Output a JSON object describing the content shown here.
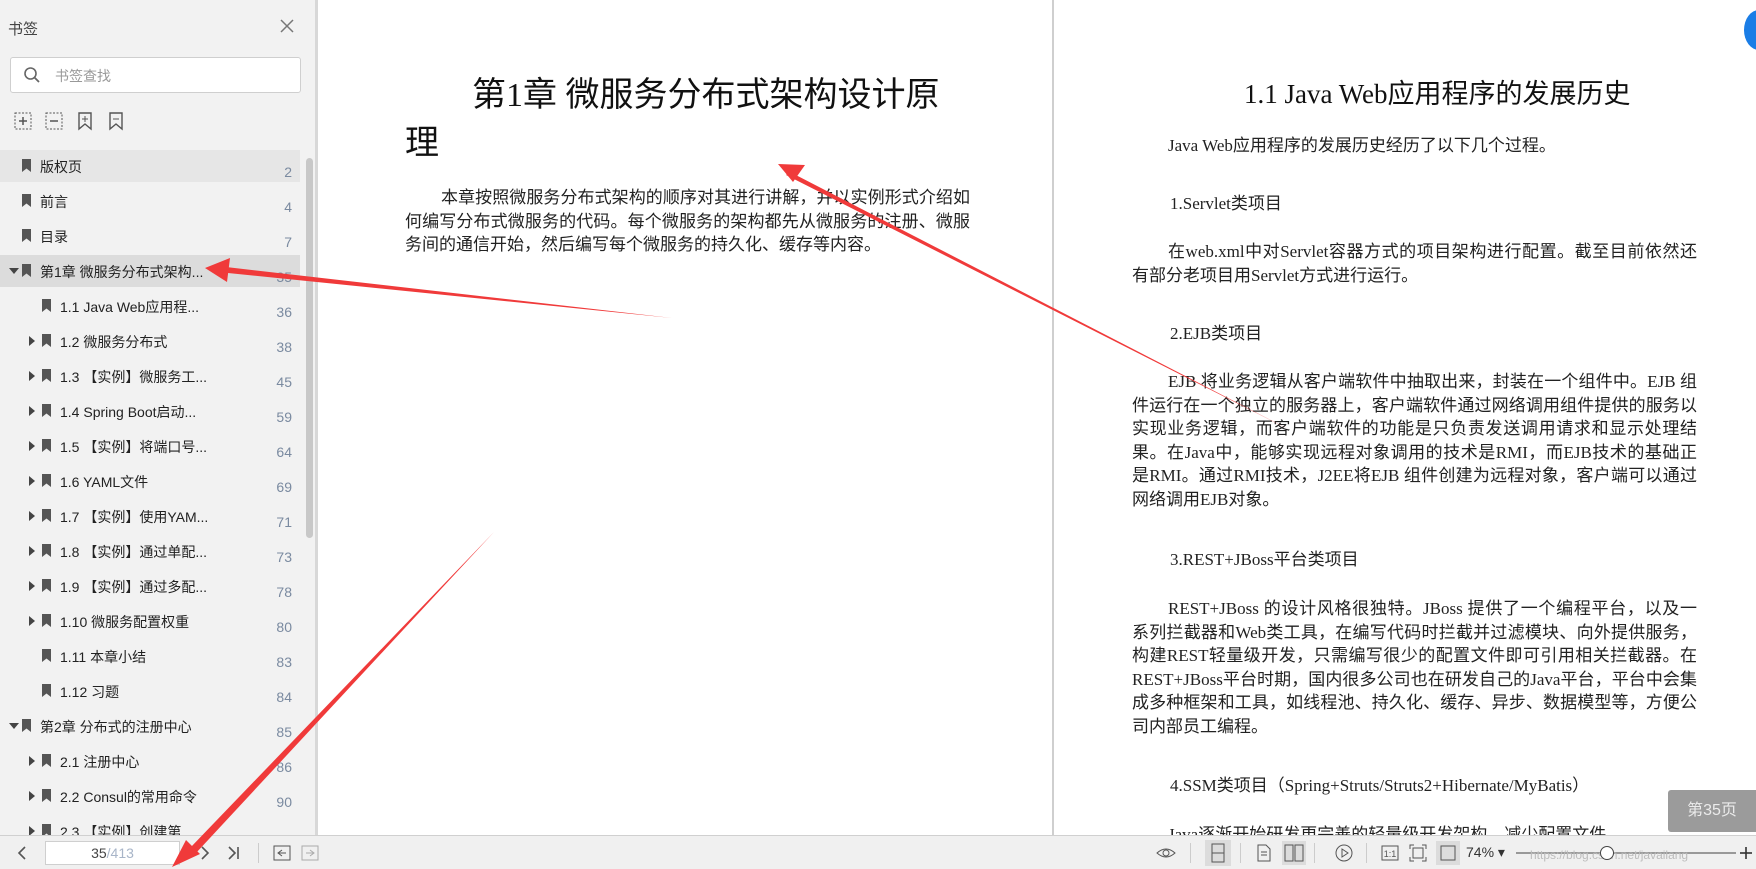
{
  "sidebar": {
    "title": "书签",
    "search_placeholder": "书签查找",
    "tools": [
      "expand-all-icon",
      "collapse-all-icon",
      "add-bookmark-icon",
      "remove-bookmark-icon"
    ],
    "items": [
      {
        "label": "版权页",
        "page": "2",
        "level": 0,
        "expander": "none"
      },
      {
        "label": "前言",
        "page": "4",
        "level": 0,
        "expander": "none"
      },
      {
        "label": "目录",
        "page": "7",
        "level": 0,
        "expander": "none"
      },
      {
        "label": "第1章 微服务分布式架构...",
        "page": "35",
        "level": 0,
        "expander": "open"
      },
      {
        "label": "1.1 Java Web应用程...",
        "page": "36",
        "level": 1,
        "expander": "none"
      },
      {
        "label": "1.2 微服务分布式",
        "page": "38",
        "level": 1,
        "expander": "closed"
      },
      {
        "label": "1.3 【实例】微服务工...",
        "page": "45",
        "level": 1,
        "expander": "closed"
      },
      {
        "label": "1.4 Spring Boot启动...",
        "page": "59",
        "level": 1,
        "expander": "closed"
      },
      {
        "label": "1.5 【实例】将端口号...",
        "page": "64",
        "level": 1,
        "expander": "closed"
      },
      {
        "label": "1.6 YAML文件",
        "page": "69",
        "level": 1,
        "expander": "closed"
      },
      {
        "label": "1.7 【实例】使用YAM...",
        "page": "71",
        "level": 1,
        "expander": "closed"
      },
      {
        "label": "1.8 【实例】通过单配...",
        "page": "73",
        "level": 1,
        "expander": "closed"
      },
      {
        "label": "1.9 【实例】通过多配...",
        "page": "78",
        "level": 1,
        "expander": "closed"
      },
      {
        "label": "1.10 微服务配置权重",
        "page": "80",
        "level": 1,
        "expander": "closed"
      },
      {
        "label": "1.11 本章小结",
        "page": "83",
        "level": 1,
        "expander": "none"
      },
      {
        "label": "1.12 习题",
        "page": "84",
        "level": 1,
        "expander": "none"
      },
      {
        "label": "第2章 分布式的注册中心",
        "page": "85",
        "level": 0,
        "expander": "open"
      },
      {
        "label": "2.1 注册中心",
        "page": "86",
        "level": 1,
        "expander": "closed"
      },
      {
        "label": "2.2 Consul的常用命令",
        "page": "90",
        "level": 1,
        "expander": "closed"
      },
      {
        "label": "2.3 【实例】创建第...",
        "page": "",
        "level": 1,
        "expander": "closed"
      }
    ]
  },
  "left_page": {
    "chapter_title": "第1章 微服务分布式架构设计原理",
    "intro": "本章按照微服务分布式架构的顺序对其进行讲解，并以实例形式介绍如何编写分布式微服务的代码。每个微服务的架构都先从微服务的注册、微服务间的通信开始，然后编写每个微服务的持久化、缓存等内容。"
  },
  "right_page": {
    "section_title": "1.1 Java Web应用程序的发展历史",
    "intro": "Java Web应用程序的发展历史经历了以下几个过程。",
    "sections": [
      {
        "heading": "1.Servlet类项目",
        "body": "在web.xml中对Servlet容器方式的项目架构进行配置。截至目前依然还有部分老项目用Servlet方式进行运行。"
      },
      {
        "heading": "2.EJB类项目",
        "body": "EJB 将业务逻辑从客户端软件中抽取出来，封装在一个组件中。EJB 组件运行在一个独立的服务器上，客户端软件通过网络调用组件提供的服务以实现业务逻辑，而客户端软件的功能是只负责发送调用请求和显示处理结果。在Java中，能够实现远程对象调用的技术是RMI，而EJB技术的基础正是RMI。通过RMI技术，J2EE将EJB 组件创建为远程对象，客户端可以通过网络调用EJB对象。"
      },
      {
        "heading": "3.REST+JBoss平台类项目",
        "body": "REST+JBoss 的设计风格很独特。JBoss 提供了一个编程平台，以及一系列拦截器和Web类工具，在编写代码时拦截并过滤模块、向外提供服务，构建REST轻量级开发，只需编写很少的配置文件即可引用相关拦截器。在REST+JBoss平台时期，国内很多公司也在研发自己的Java平台，平台中会集成多种框架和工具，如线程池、持久化、缓存、异步、数据模型等，方便公司内部员工编程。"
      },
      {
        "heading": "4.SSM类项目（Spring+Struts/Struts2+Hibernate/MyBatis）",
        "body": "Java逐渐开始研发更完善的轻量级开发架构，减少配置文件"
      }
    ],
    "page_badge": "第35页"
  },
  "toolbar": {
    "current_page": "35",
    "total_pages": "/413",
    "zoom": "74%",
    "watermark": "https://blog.csdn.net/javailang"
  },
  "colors": {
    "annotation_arrow": "#f03a3a",
    "sidebar_bg": "#f2f2f2",
    "avatar": "#1a7de6"
  }
}
